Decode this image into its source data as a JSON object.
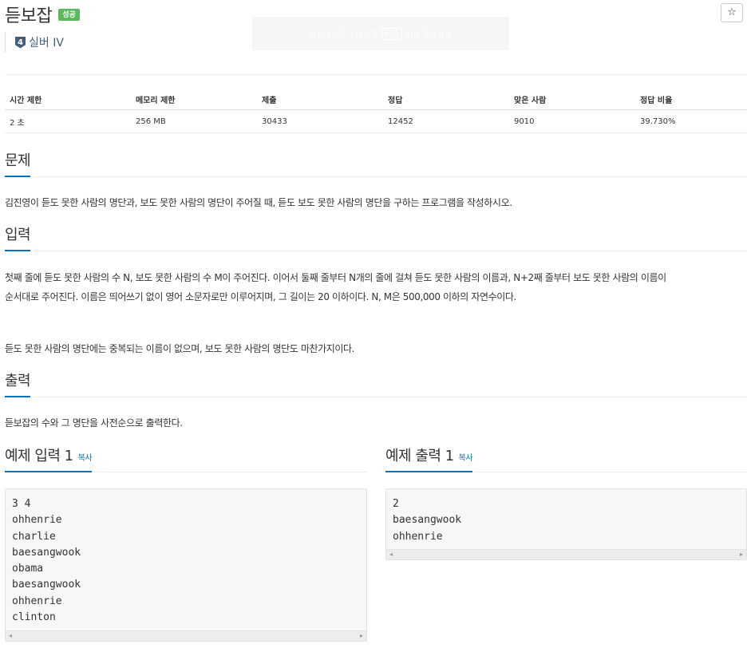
{
  "problem": {
    "title": "듣보잡",
    "status": "성공",
    "star": "☆",
    "tier_level": "4",
    "tier_name": "실버 IV"
  },
  "overlay": {
    "text_before": "공유하려는 수어이면",
    "key": "F11",
    "text_after": "키를 누르세요"
  },
  "info_table": {
    "headers": [
      "시간 제한",
      "메모리 제한",
      "제출",
      "정답",
      "맞은 사람",
      "정답 비율"
    ],
    "values": [
      "2 초",
      "256 MB",
      "30433",
      "12452",
      "9010",
      "39.730%"
    ]
  },
  "sections": {
    "problem_heading": "문제",
    "problem_text": "김진영이 듣도 못한 사람의 명단과, 보도 못한 사람의 명단이 주어질 때, 듣도 보도 못한 사람의 명단을 구하는 프로그램을 작성하시오.",
    "input_heading": "입력",
    "input_text_1": "첫째 줄에 듣도 못한 사람의 수 N, 보도 못한 사람의 수 M이 주어진다. 이어서 둘째 줄부터 N개의 줄에 걸쳐 듣도 못한 사람의 이름과, N+2째 줄부터 보도 못한 사람의 이름이",
    "input_text_2": "순서대로 주어진다. 이름은 띄어쓰기 없이 영어 소문자로만 이루어지며, 그 길이는 20 이하이다. N, M은 500,000 이하의 자연수이다.",
    "input_text_3": "듣도 못한 사람의 명단에는 중복되는 이름이 없으며, 보도 못한 사람의 명단도 마찬가지이다.",
    "output_heading": "출력",
    "output_text": "듣보잡의 수와 그 명단을 사전순으로 출력한다."
  },
  "samples": {
    "input_heading": "예제 입력 1",
    "output_heading": "예제 출력 1",
    "copy_label": "복사",
    "input_lines": [
      "3 4",
      "ohhenrie",
      "charlie",
      "baesangwook",
      "obama",
      "baesangwook",
      "ohhenrie",
      "clinton"
    ],
    "output_lines": [
      "2",
      "baesangwook",
      "ohhenrie"
    ]
  },
  "icons": {
    "scroll_left": "◂",
    "scroll_right": "▸"
  },
  "colors": {
    "accent": "#0076c0",
    "success": "#5cb85c",
    "tier_silver": "#435f7a"
  }
}
